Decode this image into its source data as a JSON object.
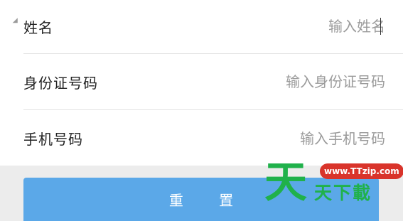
{
  "form": {
    "fields": [
      {
        "label": "姓名",
        "placeholder": "输入姓名",
        "value": ""
      },
      {
        "label": "身份证号码",
        "placeholder": "输入身份证号码",
        "value": ""
      },
      {
        "label": "手机号码",
        "placeholder": "输入手机号码",
        "value": ""
      }
    ]
  },
  "actions": {
    "reset_label": "重 置"
  },
  "watermark": {
    "big_char": "天",
    "url": "www.TTzip.com",
    "site_name": "天下載"
  },
  "colors": {
    "button": "#5ba8e8",
    "watermark_green": "#20b14b",
    "watermark_red": "#d9342b"
  }
}
